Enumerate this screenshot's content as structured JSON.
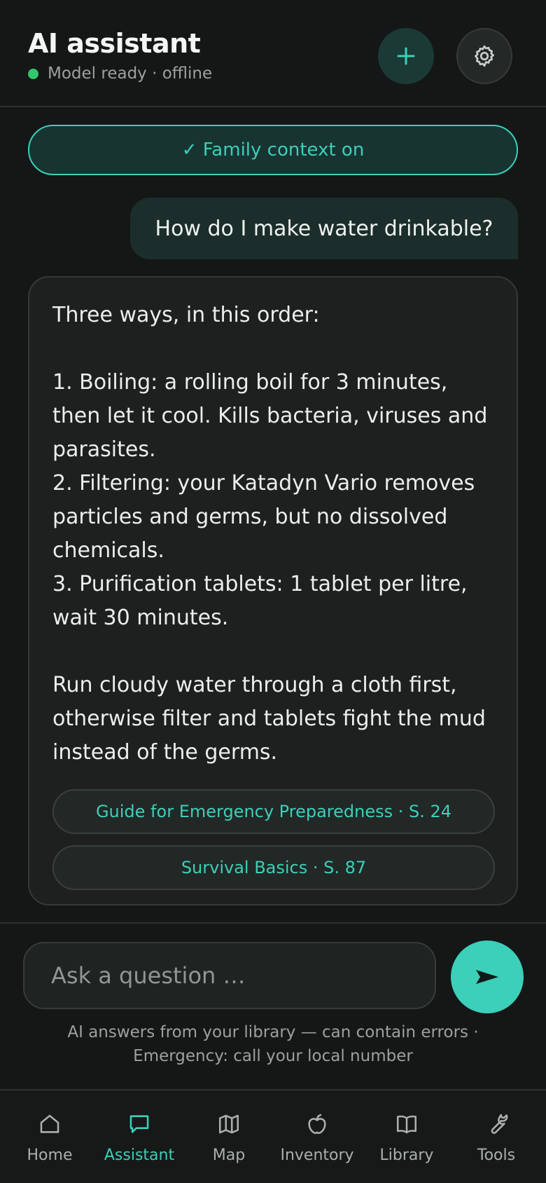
{
  "header": {
    "title": "AI assistant",
    "status": "Model ready · offline",
    "new_chat_icon": "plus-icon",
    "settings_icon": "gear-icon"
  },
  "context_pill": {
    "label": "✓ Family context on"
  },
  "messages": {
    "user": "How do I make water drinkable?",
    "assistant": "Three ways, in this order:\n\n1. Boiling: a rolling boil for 3 minutes, then let it cool. Kills bacteria, viruses and parasites.\n2. Filtering: your Katadyn Vario removes particles and germs, but no dissolved chemicals.\n3. Purification tablets: 1 tablet per litre, wait 30 minutes.\n\nRun cloudy water through a cloth first, otherwise filter and tablets fight the mud instead of the germs.",
    "sources": [
      "Guide for Emergency Preparedness · S. 24",
      "Survival Basics · S. 87"
    ]
  },
  "composer": {
    "placeholder": "Ask a question …",
    "send_icon": "send-icon",
    "disclaimer_line1": "AI answers from your library — can contain errors ·",
    "disclaimer_line2": "Emergency: call your local number"
  },
  "nav": {
    "items": [
      {
        "label": "Home",
        "icon": "home-icon"
      },
      {
        "label": "Assistant",
        "icon": "chat-icon",
        "active": true
      },
      {
        "label": "Map",
        "icon": "map-icon"
      },
      {
        "label": "Inventory",
        "icon": "apple-icon"
      },
      {
        "label": "Library",
        "icon": "book-icon"
      },
      {
        "label": "Tools",
        "icon": "wrench-icon"
      }
    ]
  },
  "colors": {
    "accent": "#3ccfb9",
    "background": "#141716",
    "status_ok": "#34c76b"
  }
}
